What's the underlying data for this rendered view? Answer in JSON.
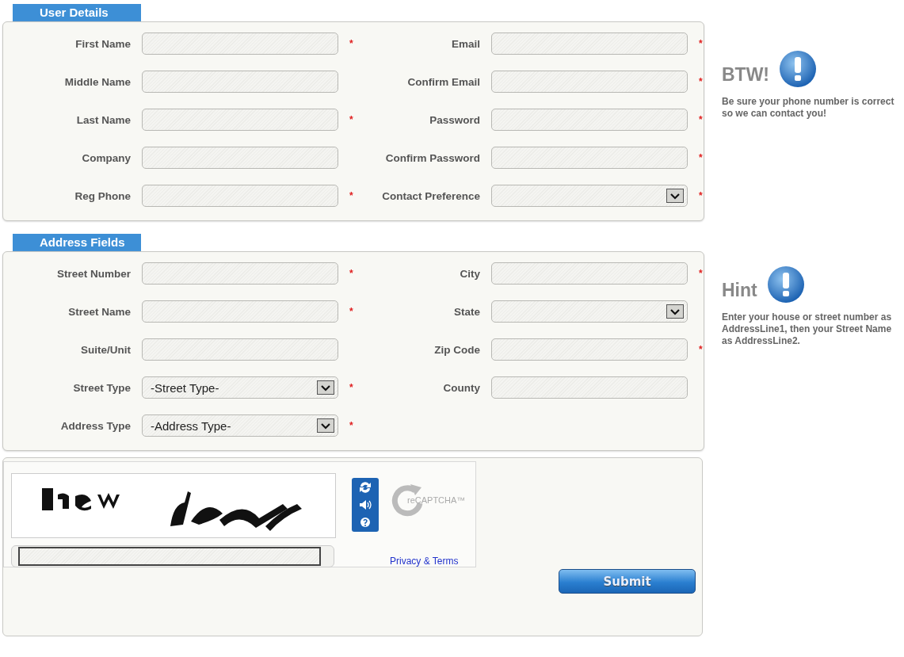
{
  "sections": [
    {
      "title": "User Details",
      "left_fields": [
        {
          "label": "First Name",
          "kind": "text",
          "required_mark": "*"
        },
        {
          "label": "Middle Name",
          "kind": "text"
        },
        {
          "label": "Last Name",
          "kind": "text",
          "required_mark": "*"
        },
        {
          "label": "Company",
          "kind": "text"
        },
        {
          "label": "Reg Phone",
          "kind": "text",
          "required_mark": "*"
        }
      ],
      "right_fields": [
        {
          "label": "Email",
          "kind": "text",
          "required_mark": "*"
        },
        {
          "label": "Confirm Email",
          "kind": "text",
          "required_mark": "*"
        },
        {
          "label": "Password",
          "kind": "text",
          "required_mark": "*"
        },
        {
          "label": "Confirm Password",
          "kind": "text",
          "required_mark": "*"
        },
        {
          "label": "Contact Preference",
          "kind": "select",
          "required_mark": "*"
        }
      ],
      "note": {
        "title": "BTW!",
        "body": "Be sure your phone number is correct so we can contact you!"
      }
    },
    {
      "title": "Address Fields",
      "left_fields": [
        {
          "label": "Street Number",
          "kind": "text",
          "required_mark": "*"
        },
        {
          "label": "Street Name",
          "kind": "text",
          "required_mark": "*"
        },
        {
          "label": "Suite/Unit",
          "kind": "text"
        },
        {
          "label": "Street Type",
          "kind": "select",
          "value": "-Street Type-",
          "required_mark": "*"
        },
        {
          "label": "Address Type",
          "kind": "select",
          "value": "-Address Type-",
          "required_mark": "*"
        }
      ],
      "right_fields": [
        {
          "label": "City",
          "kind": "text",
          "required_mark": "*"
        },
        {
          "label": "State",
          "kind": "select"
        },
        {
          "label": "Zip Code",
          "kind": "text",
          "required_mark": "*"
        },
        {
          "label": "County",
          "kind": "text"
        }
      ],
      "note": {
        "title": "Hint",
        "body": "Enter your house or street number as AddressLine1, then your Street Name as AddressLine2."
      }
    }
  ],
  "captcha": {
    "logo_text": "reCAPTCHA™",
    "link": "Privacy & Terms"
  },
  "submit": "Submit"
}
